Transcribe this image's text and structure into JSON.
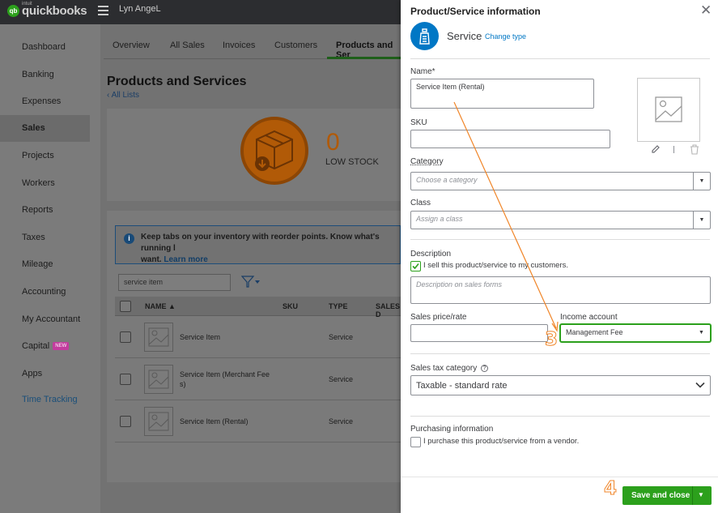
{
  "app": {
    "logo_brand": "quickbooks",
    "logo_intuit": "intuit",
    "logo_mark": "qb",
    "company_name": "Lyn AngeL"
  },
  "sidebar": {
    "items": [
      {
        "label": "Dashboard"
      },
      {
        "label": "Banking"
      },
      {
        "label": "Expenses"
      },
      {
        "label": "Sales"
      },
      {
        "label": "Projects"
      },
      {
        "label": "Workers"
      },
      {
        "label": "Reports"
      },
      {
        "label": "Taxes"
      },
      {
        "label": "Mileage"
      },
      {
        "label": "Accounting"
      },
      {
        "label": "My Accountant"
      },
      {
        "label": "Capital",
        "badge": "NEW"
      },
      {
        "label": "Apps"
      },
      {
        "label": "Time Tracking"
      }
    ],
    "active": "Sales"
  },
  "tabs": {
    "items": [
      "Overview",
      "All Sales",
      "Invoices",
      "Customers",
      "Products and Ser"
    ],
    "active": "Products and Ser"
  },
  "page": {
    "title": "Products and Services",
    "all_lists": "All Lists",
    "low_stock_count": "0",
    "low_stock_label": "LOW STOCK"
  },
  "info_banner": {
    "text": "Keep tabs on your inventory with reorder points. Know what's running l",
    "text2": "want.",
    "learn_more": "Learn more"
  },
  "search": {
    "value": "service item"
  },
  "table": {
    "columns": [
      "NAME ▲",
      "SKU",
      "TYPE",
      "SALES D"
    ],
    "rows": [
      {
        "name": "Service Item",
        "type": "Service"
      },
      {
        "name": "Service Item (Merchant Fee s)",
        "type": "Service"
      },
      {
        "name": "Service Item (Rental)",
        "type": "Service"
      }
    ]
  },
  "panel": {
    "title": "Product/Service information",
    "close_glyph": "✕",
    "item_type": "Service",
    "change_type": "Change type",
    "name_label": "Name*",
    "name_value": "Service Item (Rental)",
    "sku_label": "SKU",
    "sku_value": "",
    "category_label": "Category",
    "category_placeholder": "Choose a category",
    "class_label": "Class",
    "class_placeholder": "Assign a class",
    "description_label": "Description",
    "sell_checkbox_label": "I sell this product/service to my customers.",
    "sell_checked": true,
    "description_placeholder": "Description on sales forms",
    "sales_price_label": "Sales price/rate",
    "sales_price_value": "",
    "income_account_label": "Income account",
    "income_account_value": "Management Fee",
    "sales_tax_label": "Sales tax category",
    "sales_tax_value": "Taxable - standard rate",
    "purchasing_label": "Purchasing information",
    "purchase_checkbox_label": "I purchase this product/service from a vendor.",
    "purchase_checked": false,
    "save_label": "Save and close"
  },
  "annotations": {
    "step3": "3",
    "step4": "4",
    "color": "#f08528"
  },
  "colors": {
    "brand_green": "#2ca01c",
    "link_blue": "#0077c5",
    "badge_pink": "#c33c9e"
  }
}
